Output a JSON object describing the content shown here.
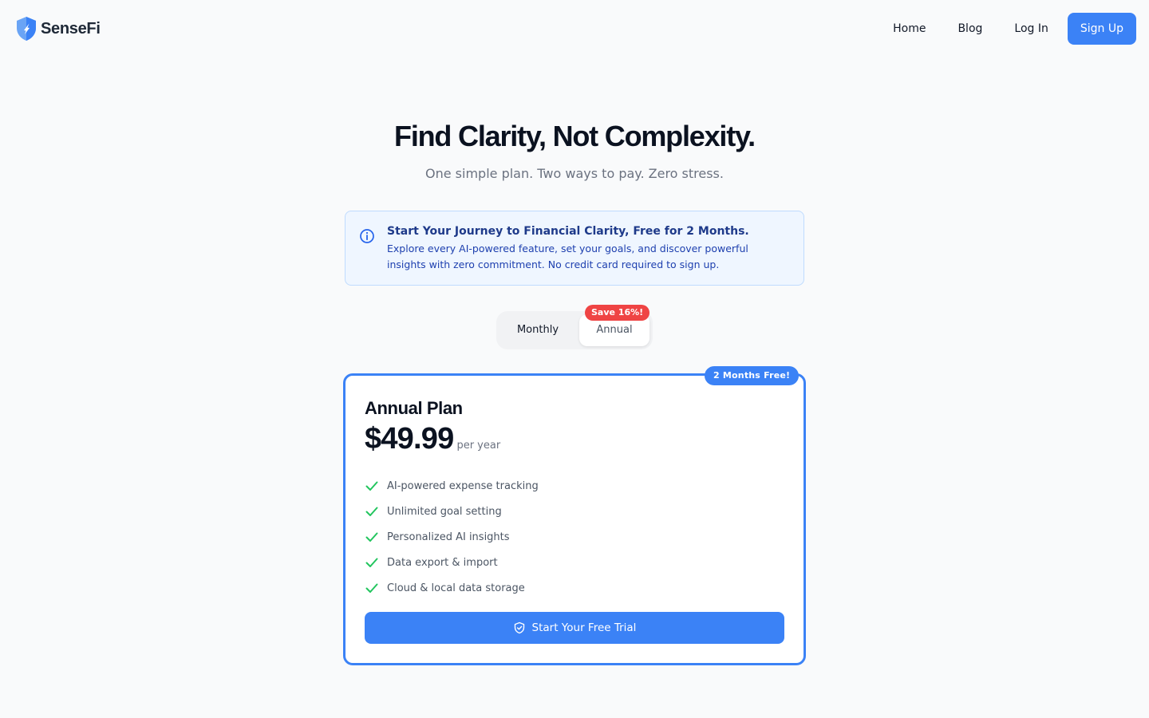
{
  "brand": {
    "name": "SenseFi"
  },
  "nav": {
    "items": [
      "Home",
      "Blog",
      "Log In"
    ],
    "signup_label": "Sign Up"
  },
  "hero": {
    "title": "Find Clarity, Not Complexity.",
    "subtitle": "One simple plan. Two ways to pay. Zero stress."
  },
  "info": {
    "icon": "info-icon",
    "title": "Start Your Journey to Financial Clarity, Free for 2 Months.",
    "text": "Explore every AI-powered feature, set your goals, and discover powerful insights with zero commitment. No credit card required to sign up."
  },
  "billing": {
    "options": [
      "Monthly",
      "Annual"
    ],
    "selected": "Annual",
    "save_badge": "Save 16%!"
  },
  "plan": {
    "badge": "2 Months Free!",
    "name": "Annual Plan",
    "price": "$49.99",
    "period": "per year",
    "features": [
      "AI-powered expense tracking",
      "Unlimited goal setting",
      "Personalized AI insights",
      "Data export & import",
      "Cloud & local data storage"
    ],
    "cta_label": "Start Your Free Trial",
    "cta_icon": "shield-check-icon"
  },
  "colors": {
    "accent": "#3b82f6",
    "badge_red": "#ef4444",
    "check_green": "#22c55e",
    "info_bg": "#eff6ff"
  }
}
